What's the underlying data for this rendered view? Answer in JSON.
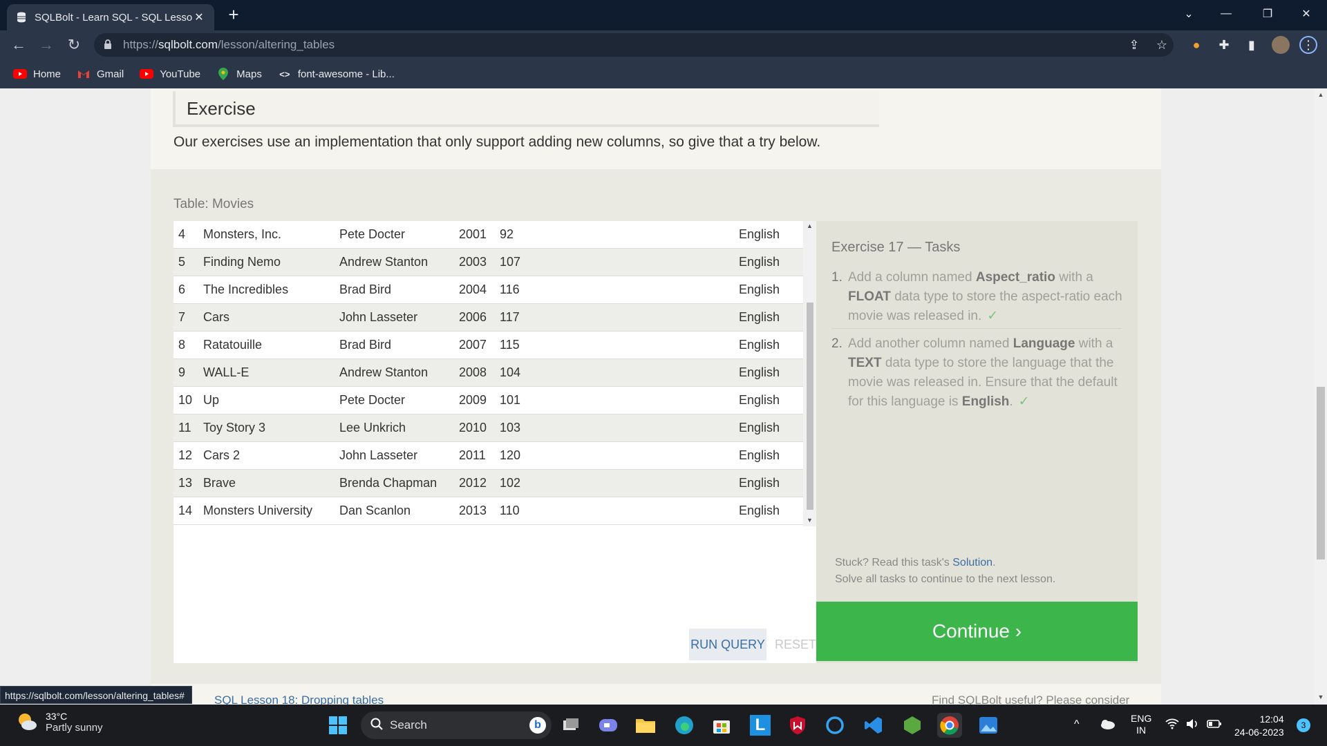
{
  "browser": {
    "tab_title": "SQLBolt - Learn SQL - SQL Lesson",
    "url_prefix": "https://",
    "url_domain": "sqlbolt.com",
    "url_path": "/lesson/altering_tables",
    "bookmarks": [
      {
        "label": "Home",
        "icon": "youtube-icon"
      },
      {
        "label": "Gmail",
        "icon": "gmail-icon"
      },
      {
        "label": "YouTube",
        "icon": "youtube-icon"
      },
      {
        "label": "Maps",
        "icon": "maps-icon"
      },
      {
        "label": "font-awesome - Lib...",
        "icon": "code-icon"
      }
    ],
    "status_url": "https://sqlbolt.com/lesson/altering_tables#"
  },
  "page": {
    "exercise_heading": "Exercise",
    "intro": "Our exercises use an implementation that only support adding new columns, so give that a try below.",
    "table_caption": "Table: Movies",
    "rows": [
      {
        "id": "4",
        "title": "Monsters, Inc.",
        "director": "Pete Docter",
        "year": "2001",
        "length": "92",
        "language": "English"
      },
      {
        "id": "5",
        "title": "Finding Nemo",
        "director": "Andrew Stanton",
        "year": "2003",
        "length": "107",
        "language": "English"
      },
      {
        "id": "6",
        "title": "The Incredibles",
        "director": "Brad Bird",
        "year": "2004",
        "length": "116",
        "language": "English"
      },
      {
        "id": "7",
        "title": "Cars",
        "director": "John Lasseter",
        "year": "2006",
        "length": "117",
        "language": "English"
      },
      {
        "id": "8",
        "title": "Ratatouille",
        "director": "Brad Bird",
        "year": "2007",
        "length": "115",
        "language": "English"
      },
      {
        "id": "9",
        "title": "WALL-E",
        "director": "Andrew Stanton",
        "year": "2008",
        "length": "104",
        "language": "English"
      },
      {
        "id": "10",
        "title": "Up",
        "director": "Pete Docter",
        "year": "2009",
        "length": "101",
        "language": "English"
      },
      {
        "id": "11",
        "title": "Toy Story 3",
        "director": "Lee Unkrich",
        "year": "2010",
        "length": "103",
        "language": "English"
      },
      {
        "id": "12",
        "title": "Cars 2",
        "director": "John Lasseter",
        "year": "2011",
        "length": "120",
        "language": "English"
      },
      {
        "id": "13",
        "title": "Brave",
        "director": "Brenda Chapman",
        "year": "2012",
        "length": "102",
        "language": "English"
      },
      {
        "id": "14",
        "title": "Monsters University",
        "director": "Dan Scanlon",
        "year": "2013",
        "length": "110",
        "language": "English"
      }
    ],
    "run_query": "RUN QUERY",
    "reset": "RESET",
    "tasks_title": "Exercise 17 — Tasks",
    "task1": {
      "num": "1.",
      "a": "Add a column named ",
      "b1": "Aspect_ratio",
      "c": " with a ",
      "b2": "FLOAT",
      "d": " data type to store the aspect-ratio each movie was released in.",
      "check": "✓"
    },
    "task2": {
      "num": "2.",
      "a": "Add another column named ",
      "b1": "Language",
      "c": " with a ",
      "b2": "TEXT",
      "d": " data type to store the language that the movie was released in. Ensure that the default for this language is ",
      "b3": "English",
      "e": ".",
      "check": "✓"
    },
    "stuck_prefix": "Stuck? Read this task's ",
    "solution_link": "Solution",
    "stuck_suffix": ".",
    "stuck_line2": "Solve all tasks to continue to the next lesson.",
    "continue": "Continue ›",
    "footer_left": "SQL Lesson 18: Dropping tables",
    "footer_right": "Find SQLBolt useful? Please consider"
  },
  "taskbar": {
    "temp": "33°C",
    "weather": "Partly sunny",
    "search": "Search",
    "lang1": "ENG",
    "lang2": "IN",
    "time": "12:04",
    "date": "24-06-2023",
    "notif_count": "3"
  },
  "colors": {
    "accent_green": "#3cb54a",
    "link_blue": "#3a6ea5"
  }
}
